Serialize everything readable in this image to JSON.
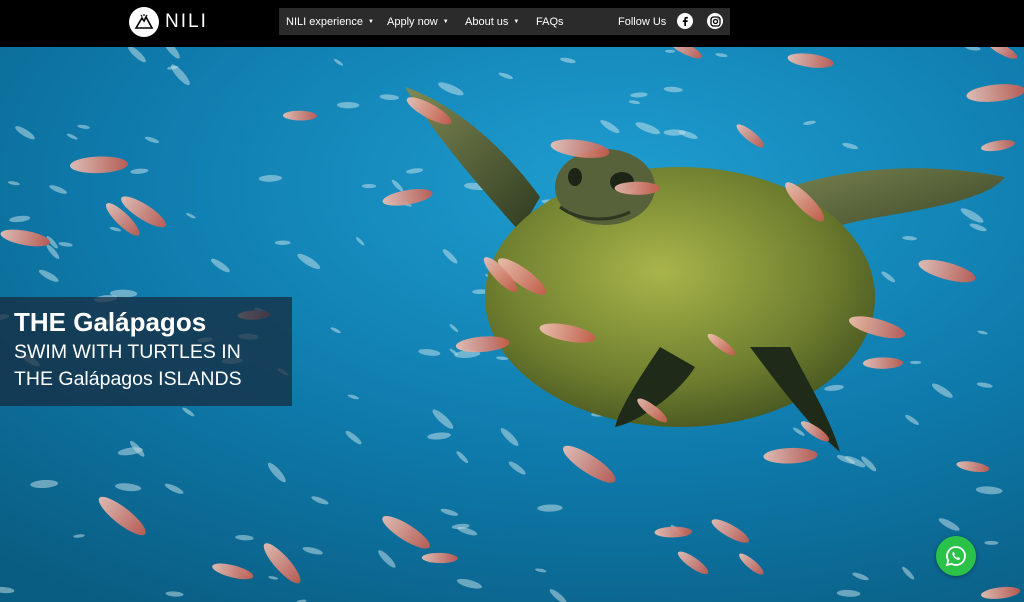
{
  "brand": {
    "name": "NILI"
  },
  "nav": {
    "items": [
      {
        "label": "NILI experience",
        "has_dropdown": true
      },
      {
        "label": "Apply now",
        "has_dropdown": true
      },
      {
        "label": "About us",
        "has_dropdown": true
      },
      {
        "label": "FAQs",
        "has_dropdown": false
      }
    ],
    "follow_label": "Follow Us",
    "social": [
      "facebook-icon",
      "instagram-icon"
    ]
  },
  "hero": {
    "title": "THE Galápagos",
    "subtitle": "SWIM WITH TURTLES IN THE Galápagos ISLANDS"
  },
  "chat": {
    "icon": "whatsapp-icon",
    "color": "#2bc24a"
  },
  "colors": {
    "topbar": "#000000",
    "nav_box": "#2b2b2b",
    "ocean": "#0f7fb0"
  }
}
